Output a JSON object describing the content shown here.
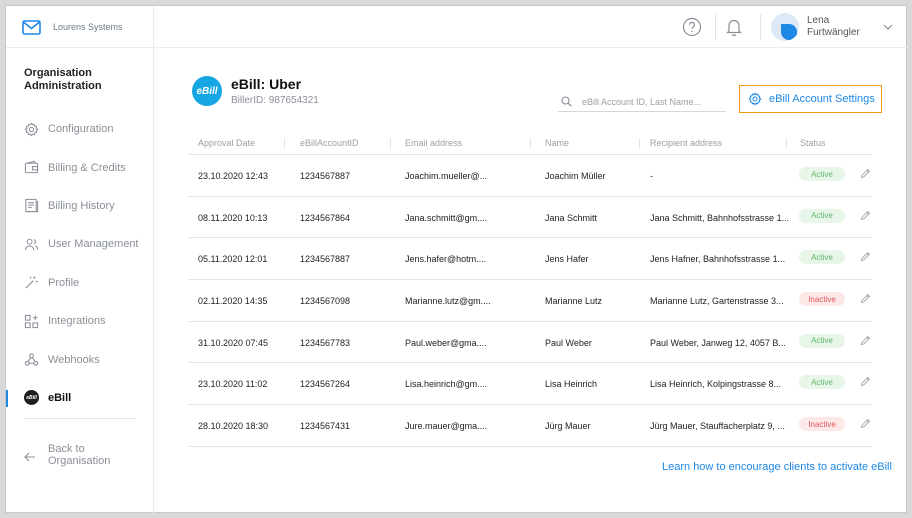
{
  "app": {
    "brand_name": "Lourens Systems"
  },
  "header": {
    "user_first": "Lena",
    "user_last": "Furtwängler"
  },
  "sidebar": {
    "title": "Organisation Administration",
    "items": [
      {
        "label": "Configuration",
        "icon": "gear-icon"
      },
      {
        "label": "Billing & Credits",
        "icon": "wallet-icon"
      },
      {
        "label": "Billing History",
        "icon": "document-icon"
      },
      {
        "label": "User Management",
        "icon": "users-icon"
      },
      {
        "label": "Profile",
        "icon": "magic-wand-icon"
      },
      {
        "label": "Integrations",
        "icon": "integrations-icon"
      },
      {
        "label": "Webhooks",
        "icon": "webhooks-icon"
      },
      {
        "label": "eBill",
        "icon": "ebill-icon"
      }
    ],
    "back_label": "Back to Organisation"
  },
  "biller": {
    "logo_text": "eBill",
    "name": "eBill: Uber",
    "id_text": "BillerID: 987654321"
  },
  "search": {
    "placeholder": "eBill Account ID, Last Name..."
  },
  "settings_button": {
    "label": "eBill Account Settings"
  },
  "table": {
    "columns": [
      "Approval Date",
      "eBillAccountID",
      "Email address",
      "Name",
      "Recipient address",
      "Status"
    ],
    "rows": [
      {
        "date": "23.10.2020 12:43",
        "account": "1234567887",
        "email": "Joachim.mueller@...",
        "name": "Joachim Müller",
        "address": "-",
        "status": "Active"
      },
      {
        "date": "08.11.2020 10:13",
        "account": "1234567864",
        "email": "Jana.schmitt@gm....",
        "name": "Jana Schmitt",
        "address": "Jana Schmitt, Bahnhofsstrasse 1...",
        "status": "Active"
      },
      {
        "date": "05.11.2020 12:01",
        "account": "1234567887",
        "email": "Jens.hafer@hotm....",
        "name": "Jens Hafer",
        "address": "Jens Hafner, Bahnhofsstrasse 1...",
        "status": "Active"
      },
      {
        "date": "02.11.2020 14:35",
        "account": "1234567098",
        "email": "Marianne.lutz@gm....",
        "name": "Marianne Lutz",
        "address": "Marianne Lutz,  Gartenstrasse 3...",
        "status": "Inactive"
      },
      {
        "date": "31.10.2020 07:45",
        "account": "1234567783",
        "email": "Paul.weber@gma....",
        "name": "Paul Weber",
        "address": "Paul Weber,  Janweg 12, 4057 B...",
        "status": "Active"
      },
      {
        "date": "23.10.2020 11:02",
        "account": "1234567264",
        "email": "Lisa.heinrich@gm....",
        "name": "Lisa Heinrich",
        "address": "Lisa Heinrich,  Kolpingstrasse 8...",
        "status": "Active"
      },
      {
        "date": "28.10.2020 18:30",
        "account": "1234567431",
        "email": "Jure.mauer@gma....",
        "name": "Jürg Mauer",
        "address": "Jürg Mauer, Stauffacherplatz 9, ...",
        "status": "Inactive"
      }
    ]
  },
  "footer_link": "Learn how to encourage clients to activate eBill",
  "colors": {
    "accent": "#1e88e5",
    "highlight": "#f39c12",
    "active": "#5db86b",
    "inactive": "#e0575b"
  }
}
